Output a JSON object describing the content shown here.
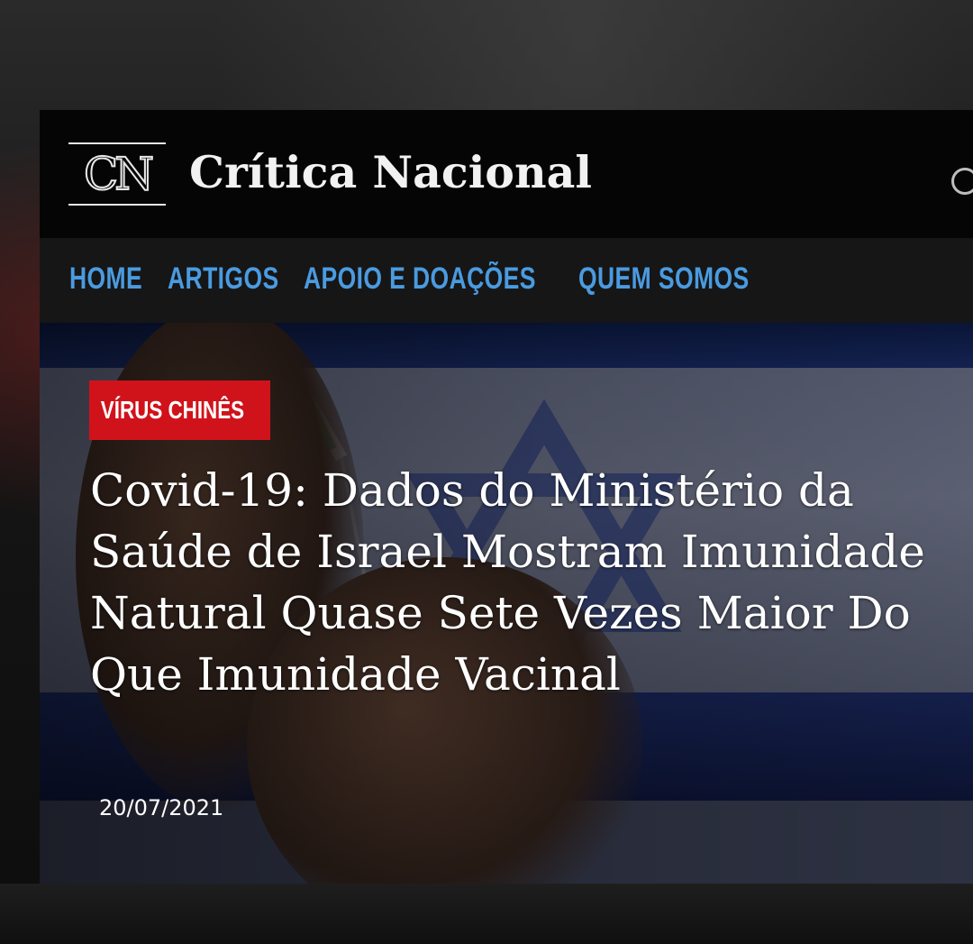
{
  "site": {
    "logo_letters": "CN",
    "title": "Crítica Nacional"
  },
  "nav": {
    "items": [
      {
        "label": "HOME"
      },
      {
        "label": "ARTIGOS"
      },
      {
        "label": "APOIO E DOAÇÕES"
      },
      {
        "label": "QUEM SOMOS"
      }
    ]
  },
  "article": {
    "category": "VÍRUS CHINÊS",
    "headline": "Covid-19: Dados do Ministério da Saúde de Israel Mostram Imunidade Natural Quase Sete Vezes Maior Do Que Imunidade Vacinal",
    "date": "20/07/2021"
  },
  "icons": {
    "search": "search-icon"
  },
  "colors": {
    "nav_link": "#4a9be0",
    "category_badge": "#d0131b",
    "header_bg": "#050505",
    "nav_bg": "#161616"
  }
}
